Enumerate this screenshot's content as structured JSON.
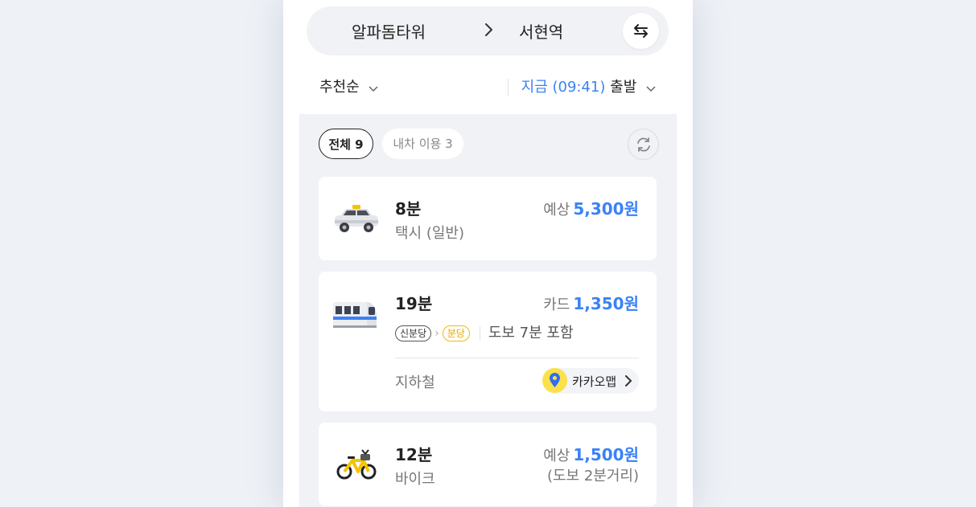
{
  "route": {
    "from": "알파돔타워",
    "to": "서현역"
  },
  "sort": {
    "label": "추천순",
    "time_now": "지금 (09:41)",
    "time_dep": "출발"
  },
  "filters": {
    "all": "전체 9",
    "taxi": "내차 이용 3"
  },
  "cards": [
    {
      "duration": "8분",
      "type": "택시 (일반)",
      "price_prefix": "예상",
      "price": "5,300원",
      "icon": "taxi-icon"
    },
    {
      "duration": "19분",
      "station_from": "신분당",
      "station_to": "분당",
      "walk": "도보 7분 포함",
      "price_prefix": "카드",
      "price": "1,350원",
      "mode": "지하철",
      "app_link": "카카오맵",
      "icon": "subway-icon"
    },
    {
      "duration": "12분",
      "type": "바이크",
      "price_prefix": "예상",
      "price": "1,500원",
      "price_note": "(도보 2분거리)",
      "icon": "bike-icon"
    }
  ],
  "colors": {
    "accent": "#3b82f6",
    "kakao_yellow": "#fbe14a",
    "bundang_line": "#f5b800"
  }
}
